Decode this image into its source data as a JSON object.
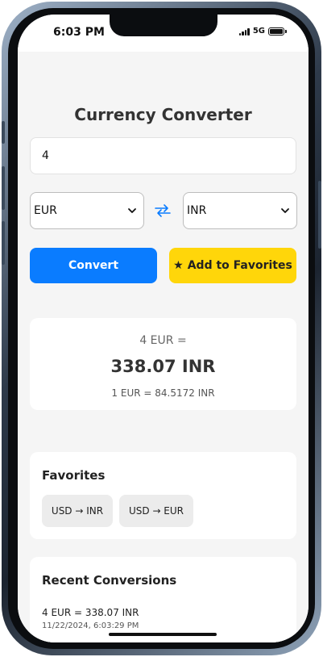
{
  "status_bar": {
    "time": "6:03 PM",
    "network": "5G"
  },
  "app": {
    "title": "Currency Converter",
    "amount": {
      "value": "4"
    },
    "from_currency": "EUR",
    "to_currency": "INR",
    "convert_label": "Convert",
    "favorite_label": "Add to Favorites",
    "icons": {
      "swap": "swap-arrows-icon",
      "star": "star-icon",
      "dropdown": "chevron-down-icon"
    },
    "colors": {
      "primary": "#0a7cff",
      "favorite": "#ffd60a",
      "background": "#f5f5f5"
    }
  },
  "result": {
    "from_text": "4 EUR =",
    "main": "338.07 INR",
    "rate": "1 EUR = 84.5172 INR"
  },
  "favorites": {
    "title": "Favorites",
    "items": [
      {
        "label": "USD → INR"
      },
      {
        "label": "USD → EUR"
      }
    ]
  },
  "recent": {
    "title": "Recent Conversions",
    "items": [
      {
        "text": "4 EUR = 338.07 INR",
        "time": "11/22/2024, 6:03:29 PM"
      }
    ]
  }
}
